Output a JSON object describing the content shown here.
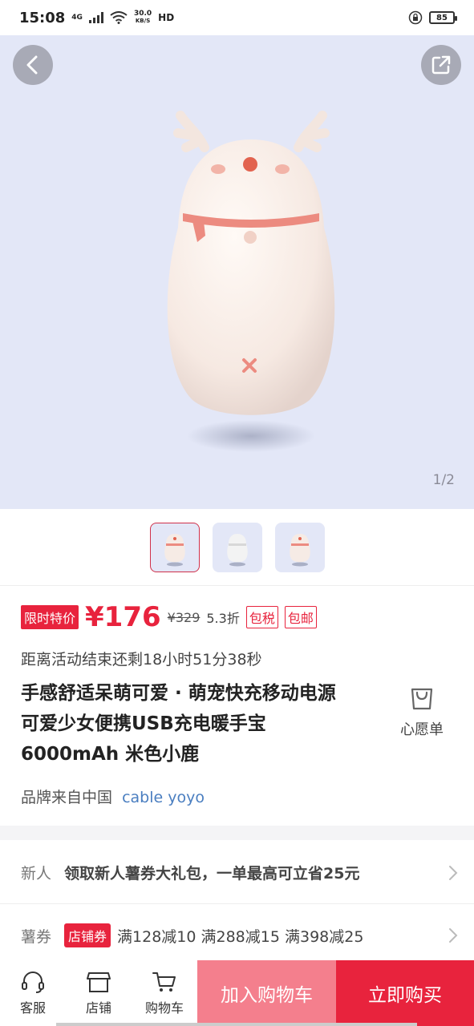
{
  "status_bar": {
    "time": "15:08",
    "network": "4G",
    "speed_value": "30.0",
    "speed_unit": "KB/S",
    "hd": "HD",
    "battery": "85"
  },
  "hero": {
    "counter": "1/2"
  },
  "price": {
    "flash_tag": "限时特价",
    "current": "¥176",
    "original": "¥329",
    "discount": "5.3折",
    "tax_tag": "包税",
    "shipping_tag": "包邮"
  },
  "countdown": "距离活动结束还剩18小时51分38秒",
  "title": "手感舒适呆萌可爱 · 萌宠快充移动电源可爱少女便携USB充电暖手宝6000mAh 米色小鹿",
  "wishlist_label": "心愿单",
  "brand": {
    "prefix": "品牌来自中国",
    "name": "cable yoyo"
  },
  "promo_rows": {
    "new_user_label": "新人",
    "new_user_text": "领取新人薯券大礼包，一单最高可立省25元",
    "coupon_label": "薯券",
    "coupon_tag": "店铺券",
    "coupon_text": "满128减10 满288减15 满398减25"
  },
  "bottom_nav": {
    "service": "客服",
    "shop": "店铺",
    "cart": "购物车",
    "add_to_cart": "加入购物车",
    "buy_now": "立即购买"
  },
  "colors": {
    "accent": "#e8233d",
    "cart_button": "#f47f8d",
    "hero_bg": "#e3e7f7",
    "brand_link": "#4a7ec0"
  }
}
